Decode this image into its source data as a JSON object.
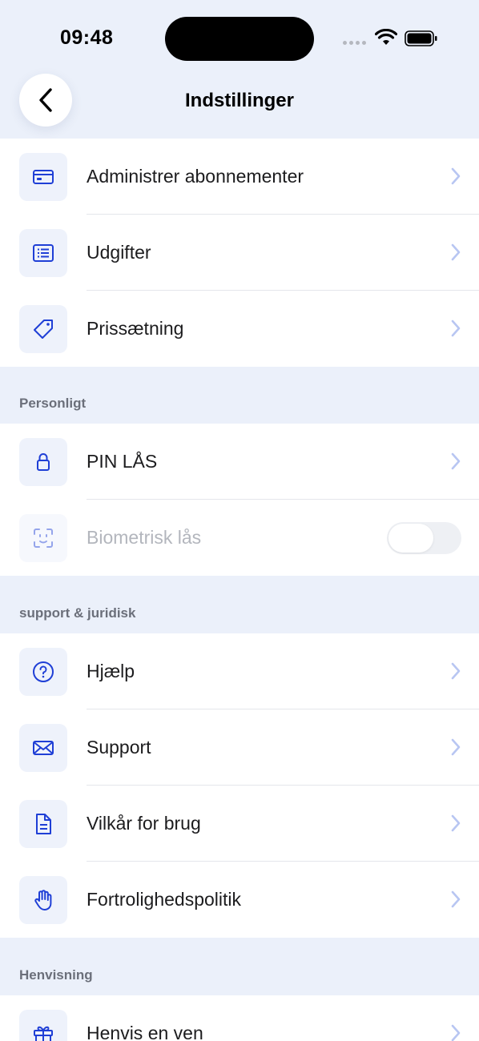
{
  "status": {
    "time": "09:48"
  },
  "header": {
    "title": "Indstillinger"
  },
  "colors": {
    "accent": "#1f3fd6",
    "chevron": "#b8c6f2",
    "background": "#ebf0fa"
  },
  "group1": {
    "items": [
      {
        "label": "Administrer abonnementer",
        "icon": "credit-card-icon"
      },
      {
        "label": "Udgifter",
        "icon": "list-icon"
      },
      {
        "label": "Prissætning",
        "icon": "tag-icon"
      }
    ]
  },
  "personal": {
    "header": "Personligt",
    "items": [
      {
        "label": "PIN LÅS",
        "icon": "lock-icon"
      },
      {
        "label": "Biometrisk lås",
        "icon": "face-id-icon",
        "toggle": false,
        "disabled": true
      }
    ]
  },
  "support": {
    "header": "support & juridisk",
    "items": [
      {
        "label": "Hjælp",
        "icon": "help-icon"
      },
      {
        "label": "Support",
        "icon": "mail-icon"
      },
      {
        "label": "Vilkår for brug",
        "icon": "document-icon"
      },
      {
        "label": "Fortrolighedspolitik",
        "icon": "hand-icon"
      }
    ]
  },
  "referral": {
    "header": "Henvisning",
    "items": [
      {
        "label": "Henvis en ven",
        "icon": "gift-icon"
      }
    ]
  }
}
